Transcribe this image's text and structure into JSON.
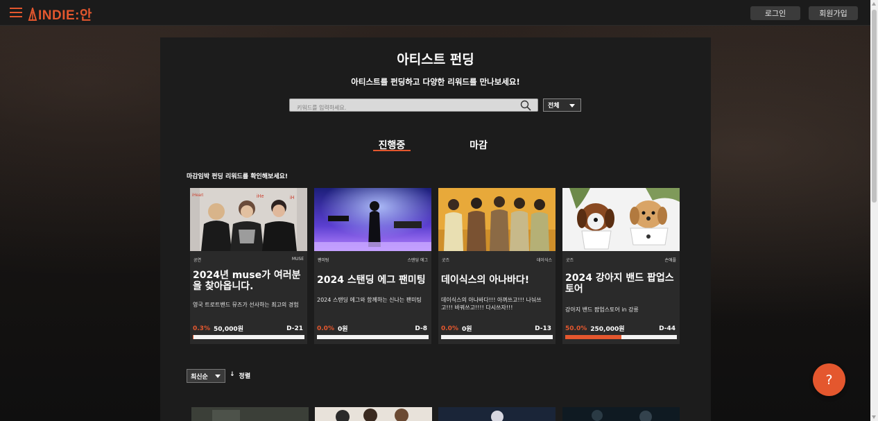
{
  "header": {
    "logo_text": "INDIE:안",
    "login_label": "로그인",
    "signup_label": "회원가입"
  },
  "page": {
    "title": "아티스트 펀딩",
    "subtitle": "아티스트를 펀딩하고 다양한 리워드를 만나보세요!"
  },
  "search": {
    "placeholder": "키워드를 입력하세요.",
    "filter_selected": "전체"
  },
  "tabs": [
    {
      "label": "진행중",
      "active": true
    },
    {
      "label": "마감",
      "active": false
    }
  ],
  "section_label": "마감임박 펀딩 리워드를 확인해보세요!",
  "cards": [
    {
      "category": "공연",
      "artist": "MUSE",
      "title": "2024년 muse가 여러분을 찾아옵니다.",
      "description": "영국 트로트밴드 뮤즈가 선사하는 최고의 경험",
      "percent": "0.3%",
      "amount": "50,000원",
      "dday": "D-21",
      "progress": 0.003
    },
    {
      "category": "팬미팅",
      "artist": "스탠딩 에그",
      "title": "2024 스탠딩 에그 팬미팅",
      "description": "2024 스탠딩 에그와 함께하는 신나는 팬미팅",
      "percent": "0.0%",
      "amount": "0원",
      "dday": "D-8",
      "progress": 0.0
    },
    {
      "category": "굿즈",
      "artist": "데이식스",
      "title": "데이식스의 아나바다!",
      "description": "데이식스의 아나바다!!! 아껴쓰고!!! 나눠쓰고!!! 바꿔쓰고!!!! 다시쓰자!!!",
      "percent": "0.0%",
      "amount": "0원",
      "dday": "D-13",
      "progress": 0.0
    },
    {
      "category": "굿즈",
      "artist": "손애플",
      "title": "2024 강아지 밴드 팝업스토어",
      "description": "강아지 밴드 팝업스토어 in 강릉",
      "percent": "50.0%",
      "amount": "250,000원",
      "dday": "D-44",
      "progress": 0.5
    }
  ],
  "sort": {
    "selected": "최신순",
    "direction_icon": "arrow-down",
    "direction_label": "정렬"
  },
  "help_label": "?",
  "colors": {
    "accent": "#e4572e",
    "panel": "#1c1c1c",
    "card": "#2a2a2a"
  }
}
